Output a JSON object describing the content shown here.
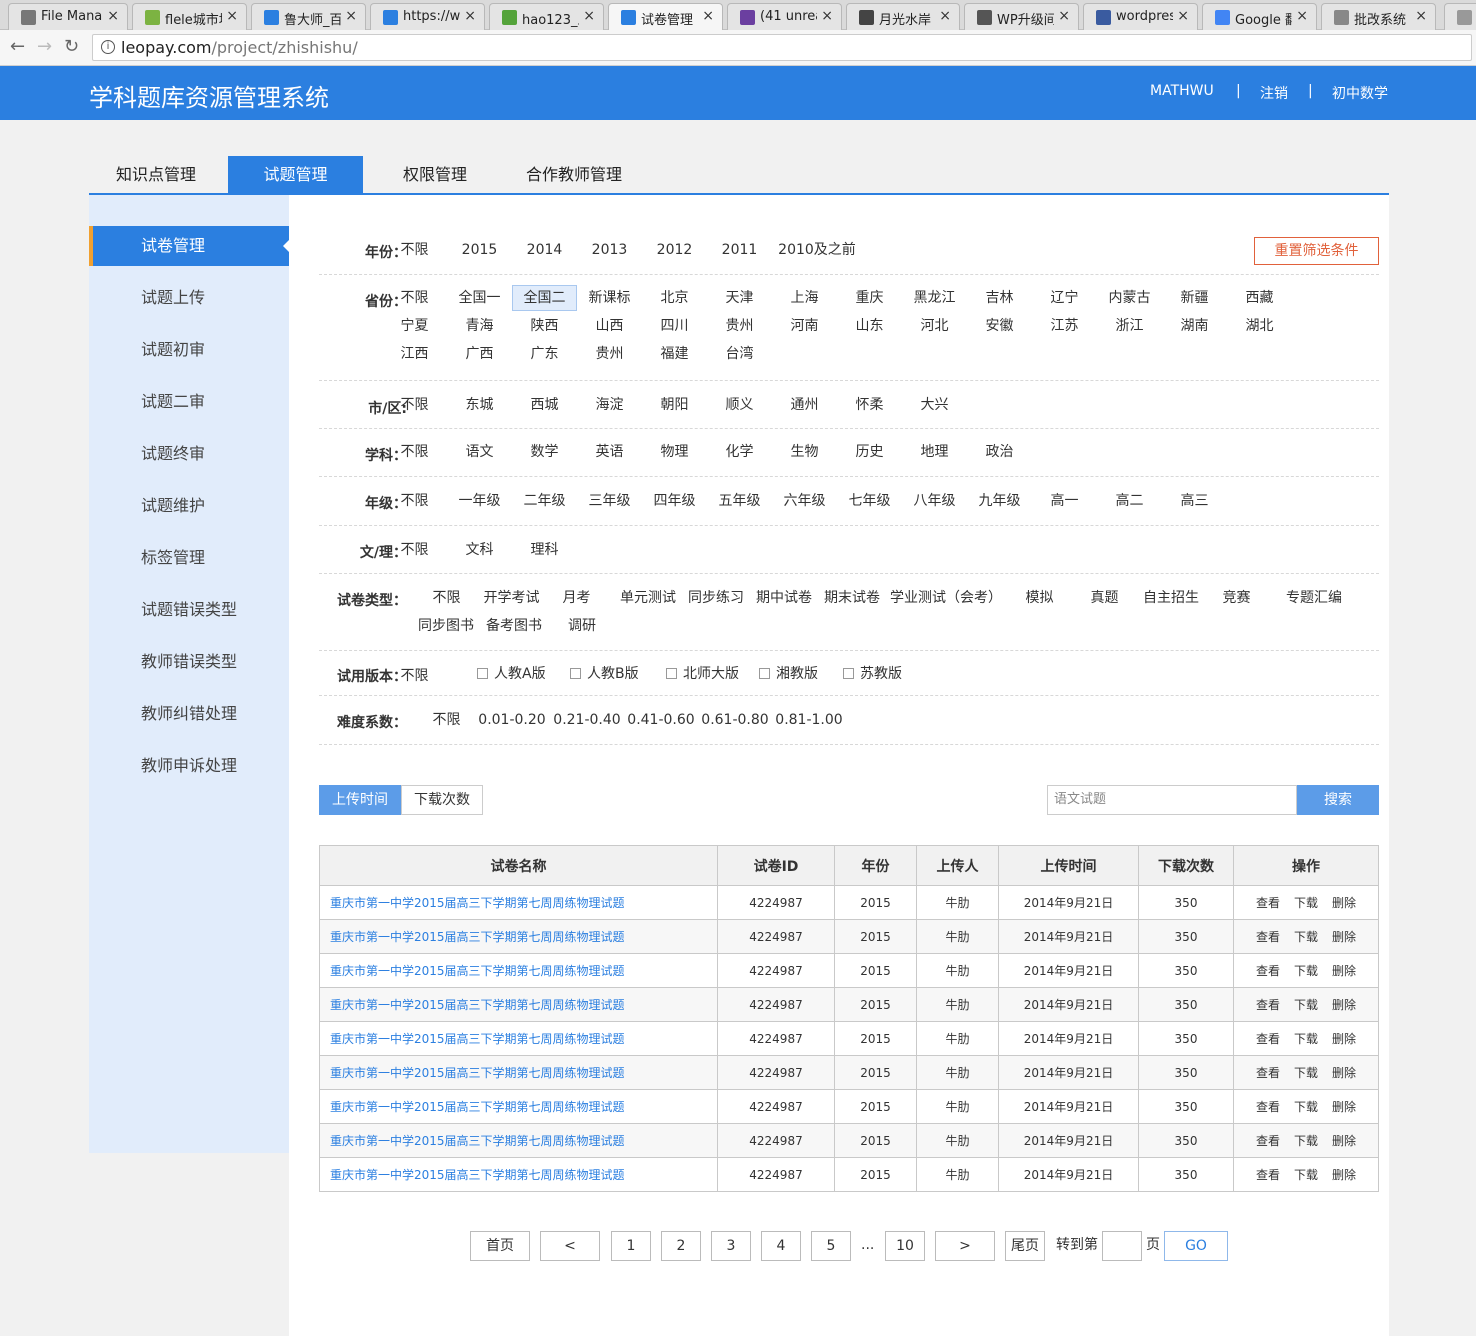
{
  "browser": {
    "tabs": [
      {
        "title": "File Mana",
        "color": "#777777"
      },
      {
        "title": "flele城市坟",
        "color": "#7cb342"
      },
      {
        "title": "鲁大师_百",
        "color": "#2b7fe0"
      },
      {
        "title": "https://w",
        "color": "#2b7fe0"
      },
      {
        "title": "hao123_上",
        "color": "#54a33a"
      },
      {
        "title": "试卷管理",
        "color": "#2b7fe0"
      },
      {
        "title": "(41 unrea",
        "color": "#6b3fa0"
      },
      {
        "title": "月光水岸",
        "color": "#444444"
      },
      {
        "title": "WP升级间",
        "color": "#555555"
      },
      {
        "title": "wordpres",
        "color": "#3a5ba0"
      },
      {
        "title": "Google 翻",
        "color": "#4285f4"
      },
      {
        "title": "批改系统",
        "color": "#888888"
      }
    ],
    "url_host": "leopay.com",
    "url_path": "/project/zhishishu/"
  },
  "header": {
    "title": "学科题库资源管理系统",
    "user": "MATHWU",
    "sep": "|",
    "logout": "注销",
    "subject": "初中数学"
  },
  "main_tabs": [
    "知识点管理",
    "试题管理",
    "权限管理",
    "合作教师管理"
  ],
  "sidebar": [
    "试卷管理",
    "试题上传",
    "试题初审",
    "试题二审",
    "试题终审",
    "试题维护",
    "标签管理",
    "试题错误类型",
    "教师错误类型",
    "教师纠错处理",
    "教师申诉处理"
  ],
  "filters": {
    "year": {
      "label": "年份：",
      "options": [
        "不限",
        "2015",
        "2014",
        "2013",
        "2012",
        "2011",
        "2010及之前"
      ]
    },
    "province": {
      "label": "省份：",
      "rows": [
        [
          "不限",
          "全国一",
          "全国二",
          "新课标",
          "北京",
          "天津",
          "上海",
          "重庆",
          "黑龙江",
          "吉林",
          "辽宁",
          "内蒙古",
          "新疆",
          "西藏"
        ],
        [
          "宁夏",
          "青海",
          "陕西",
          "山西",
          "四川",
          "贵州",
          "河南",
          "山东",
          "河北",
          "安徽",
          "江苏",
          "浙江",
          "湖南",
          "湖北"
        ],
        [
          "江西",
          "广西",
          "广东",
          "贵州",
          "福建",
          "台湾"
        ]
      ],
      "selected": "全国二"
    },
    "city": {
      "label": "市/区:",
      "options": [
        "不限",
        "东城",
        "西城",
        "海淀",
        "朝阳",
        "顺义",
        "通州",
        "怀柔",
        "大兴"
      ]
    },
    "subject": {
      "label": "学科：",
      "options": [
        "不限",
        "语文",
        "数学",
        "英语",
        "物理",
        "化学",
        "生物",
        "历史",
        "地理",
        "政治"
      ]
    },
    "grade": {
      "label": "年级：",
      "options": [
        "不限",
        "一年级",
        "二年级",
        "三年级",
        "四年级",
        "五年级",
        "六年级",
        "七年级",
        "八年级",
        "九年级",
        "高一",
        "高二",
        "高三"
      ]
    },
    "track": {
      "label": "文/理：",
      "options": [
        "不限",
        "文科",
        "理科"
      ]
    },
    "paper_type": {
      "label": "试卷类型：",
      "row1": [
        "不限",
        "开学考试",
        "月考",
        "单元测试",
        "同步练习",
        "期中试卷",
        "期末试卷",
        "学业测试（会考）",
        "模拟",
        "真题",
        "自主招生",
        "竞赛",
        "专题汇编"
      ],
      "row2": [
        "同步图书",
        "备考图书",
        "调研"
      ]
    },
    "edition": {
      "label": "试用版本：",
      "any": "不限",
      "checkboxes": [
        "人教A版",
        "人教B版",
        "北师大版",
        "湘教版",
        "苏教版"
      ]
    },
    "difficulty": {
      "label": "难度系数：",
      "options": [
        "不限",
        "0.01-0.20",
        "0.21-0.40",
        "0.41-0.60",
        "0.61-0.80",
        "0.81-1.00"
      ]
    },
    "reset": "重置筛选条件"
  },
  "sort": {
    "upload_time": "上传时间",
    "downloads": "下载次数"
  },
  "search": {
    "placeholder": "语文试题",
    "button": "搜索"
  },
  "table": {
    "headers": [
      "试卷名称",
      "试卷ID",
      "年份",
      "上传人",
      "上传时间",
      "下载次数",
      "操作"
    ],
    "ops": [
      "查看",
      "下载",
      "删除"
    ],
    "rows": [
      {
        "name": "重庆市第一中学2015届高三下学期第七周周练物理试题",
        "id": "4224987",
        "year": "2015",
        "uploader": "牛肋",
        "time": "2014年9月21日",
        "downloads": "350"
      },
      {
        "name": "重庆市第一中学2015届高三下学期第七周周练物理试题",
        "id": "4224987",
        "year": "2015",
        "uploader": "牛肋",
        "time": "2014年9月21日",
        "downloads": "350"
      },
      {
        "name": "重庆市第一中学2015届高三下学期第七周周练物理试题",
        "id": "4224987",
        "year": "2015",
        "uploader": "牛肋",
        "time": "2014年9月21日",
        "downloads": "350"
      },
      {
        "name": "重庆市第一中学2015届高三下学期第七周周练物理试题",
        "id": "4224987",
        "year": "2015",
        "uploader": "牛肋",
        "time": "2014年9月21日",
        "downloads": "350"
      },
      {
        "name": "重庆市第一中学2015届高三下学期第七周周练物理试题",
        "id": "4224987",
        "year": "2015",
        "uploader": "牛肋",
        "time": "2014年9月21日",
        "downloads": "350"
      },
      {
        "name": "重庆市第一中学2015届高三下学期第七周周练物理试题",
        "id": "4224987",
        "year": "2015",
        "uploader": "牛肋",
        "time": "2014年9月21日",
        "downloads": "350"
      },
      {
        "name": "重庆市第一中学2015届高三下学期第七周周练物理试题",
        "id": "4224987",
        "year": "2015",
        "uploader": "牛肋",
        "time": "2014年9月21日",
        "downloads": "350"
      },
      {
        "name": "重庆市第一中学2015届高三下学期第七周周练物理试题",
        "id": "4224987",
        "year": "2015",
        "uploader": "牛肋",
        "time": "2014年9月21日",
        "downloads": "350"
      },
      {
        "name": "重庆市第一中学2015届高三下学期第七周周练物理试题",
        "id": "4224987",
        "year": "2015",
        "uploader": "牛肋",
        "time": "2014年9月21日",
        "downloads": "350"
      }
    ]
  },
  "pagination": {
    "first": "首页",
    "prev": "<",
    "pages": [
      "1",
      "2",
      "3",
      "4",
      "5"
    ],
    "ellipsis": "...",
    "last_page": "10",
    "next": ">",
    "last": "尾页",
    "goto_prefix": "转到第",
    "goto_suffix": "页",
    "go": "GO"
  }
}
